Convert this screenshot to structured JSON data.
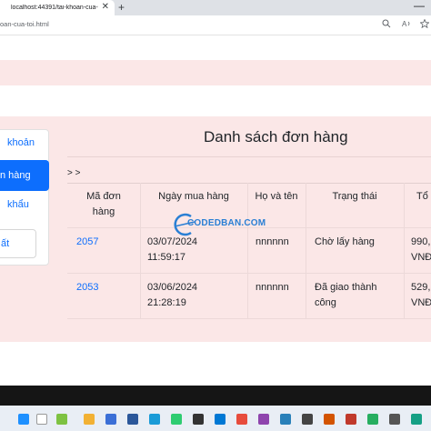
{
  "browser": {
    "tab_title": "localhost:44391/tai-khoan-cua-t",
    "tab_close": "✕",
    "new_tab": "+",
    "minimize": "—",
    "url": "oan-cua-toi.html"
  },
  "sidebar": {
    "items": [
      {
        "label": "khoản"
      },
      {
        "label": "n hàng"
      },
      {
        "label": "khẩu"
      },
      {
        "label": "ất"
      }
    ]
  },
  "main": {
    "title": "Danh sách đơn hàng",
    "breadcrumb": "> >",
    "table": {
      "headers": {
        "order_id": "Mã đơn hàng",
        "date": "Ngày mua hàng",
        "name": "Họ và tên",
        "status": "Trạng thái",
        "total": "Tổ"
      },
      "rows": [
        {
          "order_id": "2057",
          "date": "03/07/2024 11:59:17",
          "name": "nnnnnn",
          "status": "Chờ lấy hàng",
          "total": "990,",
          "currency": "VNĐ"
        },
        {
          "order_id": "2053",
          "date": "03/06/2024 21:28:19",
          "name": "nnnnnn",
          "status": "Đã giao thành công",
          "total": "529,",
          "currency": "VNĐ"
        }
      ]
    }
  },
  "watermark": "CODEDBAN.COM",
  "colors": {
    "accent": "#0d6efd",
    "band": "#fbe7e7"
  }
}
